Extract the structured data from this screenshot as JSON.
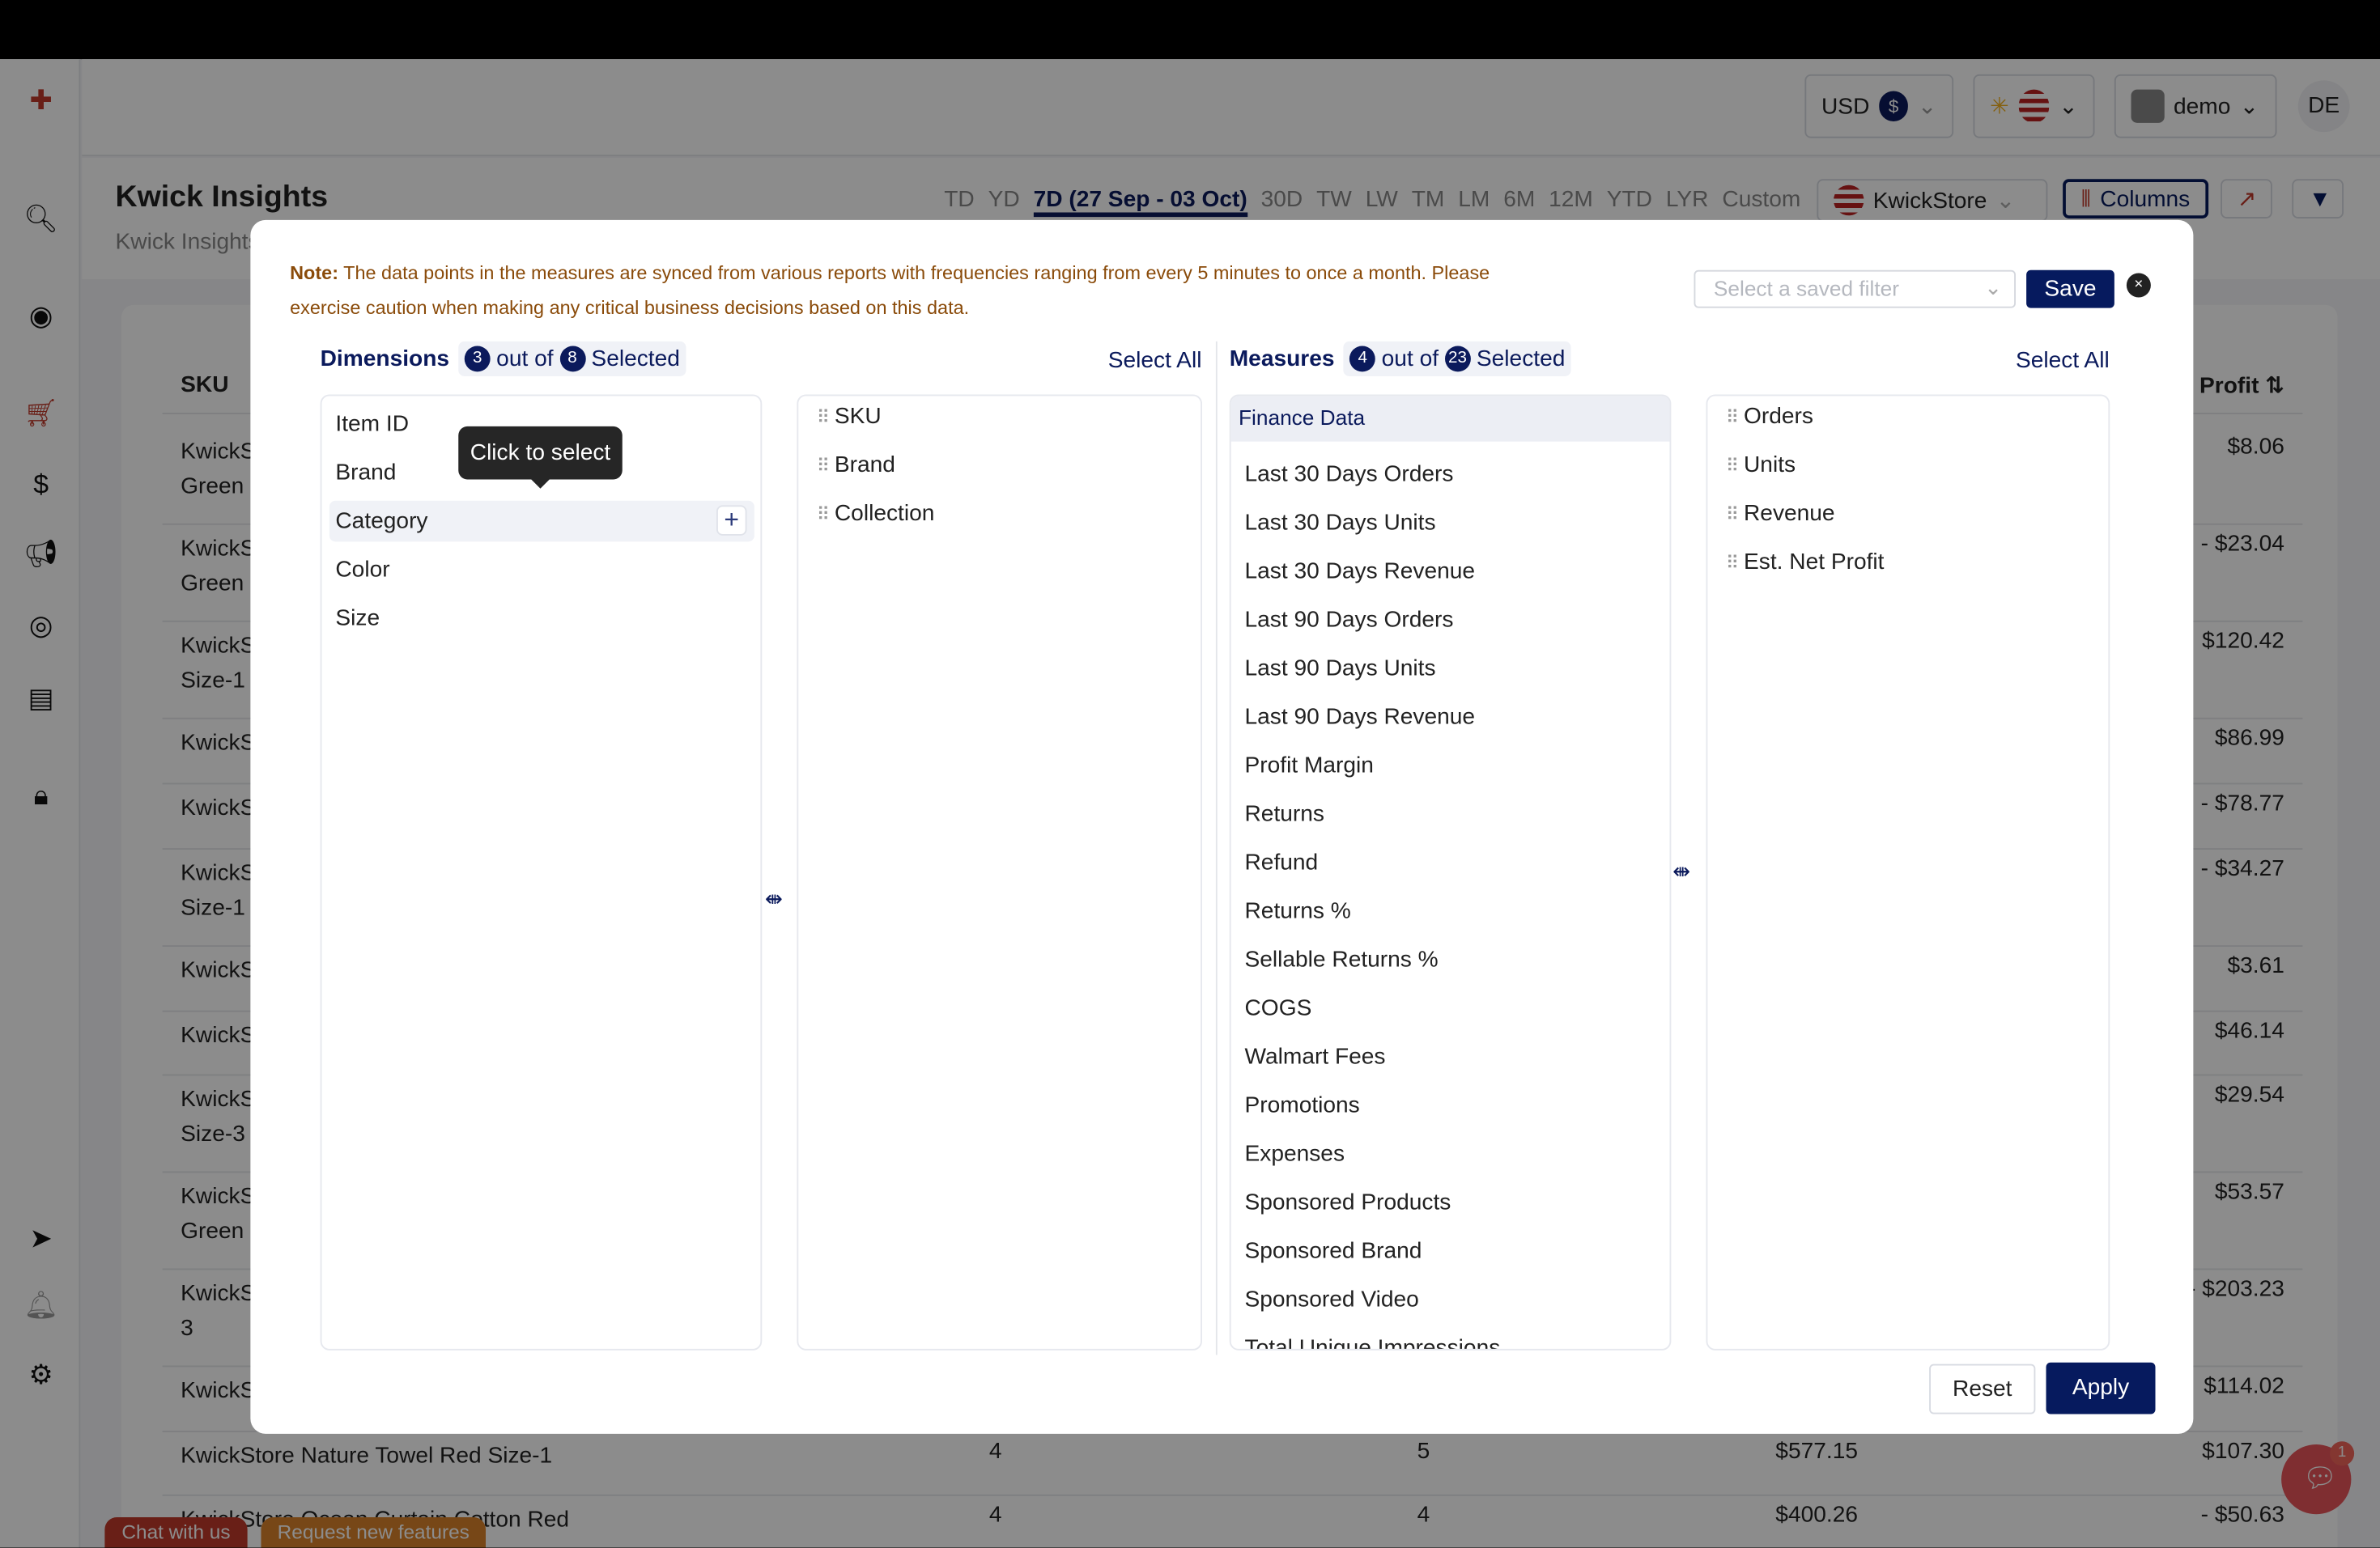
{
  "header": {
    "currency": "USD",
    "currency_symbol": "$",
    "user": "demo",
    "initials": "DE"
  },
  "page": {
    "title": "Kwick Insights",
    "breadcrumb": "Kwick Insights",
    "ranges": [
      "TD",
      "YD",
      "7D (27 Sep - 03 Oct)",
      "30D",
      "TW",
      "LW",
      "TM",
      "LM",
      "6M",
      "12M",
      "YTD",
      "LYR",
      "Custom"
    ],
    "active_range": "7D (27 Sep - 03 Oct)",
    "store": "KwickStore",
    "columns_label": "Columns"
  },
  "table": {
    "headers": {
      "sku": "SKU",
      "profit": "Est. Net Profit"
    },
    "rows": [
      {
        "sku": "KwickS",
        "sku2": "Green S",
        "profit": "$8.06"
      },
      {
        "sku": "KwickS",
        "sku2": "Green S",
        "profit": "- $23.04"
      },
      {
        "sku": "KwickS",
        "sku2": "Size-1",
        "profit": "$120.42"
      },
      {
        "sku": "KwickS",
        "sku2": "",
        "profit": "$86.99"
      },
      {
        "sku": "KwickS",
        "sku2": "",
        "profit": "- $78.77"
      },
      {
        "sku": "KwickS",
        "sku2": "Size-1",
        "profit": "- $34.27"
      },
      {
        "sku": "KwickS",
        "sku2": "",
        "profit": "$3.61"
      },
      {
        "sku": "KwickS",
        "sku2": "",
        "profit": "$46.14"
      },
      {
        "sku": "KwickS",
        "sku2": "Size-3",
        "profit": "$29.54"
      },
      {
        "sku": "KwickS",
        "sku2": "Green S",
        "profit": "$53.57"
      },
      {
        "sku": "KwickS",
        "sku2": "3",
        "profit": "- $203.23"
      },
      {
        "sku": "KwickS",
        "sku2": "",
        "profit": "$114.02"
      }
    ],
    "full_rows": [
      {
        "sku": "KwickStore Nature Towel Red Size-1",
        "orders": "4",
        "units": "5",
        "revenue": "$577.15",
        "profit": "$107.30"
      },
      {
        "sku": "KwickStore Ocean Curtain Cotton Red",
        "orders": "4",
        "units": "4",
        "revenue": "$400.26",
        "profit": "- $50.63"
      }
    ]
  },
  "footer": {
    "chat": "Chat with us",
    "request": "Request new features",
    "chat_badge": "1"
  },
  "modal": {
    "note_label": "Note:",
    "note": "The data points in the measures are synced from various reports with frequencies ranging from every 5 minutes to once a month. Please exercise caution when making any critical business decisions based on this data.",
    "saved_filter_placeholder": "Select a saved filter",
    "save": "Save",
    "close": "×",
    "dimensions": {
      "title": "Dimensions",
      "selected": "3",
      "out_of": "out of",
      "total": "8",
      "selected_label": "Selected",
      "select_all": "Select All",
      "available": [
        "Item ID",
        "Brand",
        "Category",
        "Color",
        "Size"
      ],
      "hovered": "Category",
      "tooltip": "Click to select",
      "chosen": [
        "SKU",
        "Brand",
        "Collection"
      ]
    },
    "measures": {
      "title": "Measures",
      "selected": "4",
      "out_of": "out of",
      "total": "23",
      "selected_label": "Selected",
      "select_all": "Select All",
      "group": "Finance Data",
      "available": [
        "Last 30 Days Orders",
        "Last 30 Days Units",
        "Last 30 Days Revenue",
        "Last 90 Days Orders",
        "Last 90 Days Units",
        "Last 90 Days Revenue",
        "Profit Margin",
        "Returns",
        "Refund",
        "Returns %",
        "Sellable Returns %",
        "COGS",
        "Walmart Fees",
        "Promotions",
        "Expenses",
        "Sponsored Products",
        "Sponsored Brand",
        "Sponsored Video",
        "Total Unique Impressions"
      ],
      "chosen": [
        "Orders",
        "Units",
        "Revenue",
        "Est. Net Profit"
      ]
    },
    "reset": "Reset",
    "apply": "Apply"
  },
  "colors": {
    "primary": "#061a5e",
    "note": "#8a4b0a",
    "chat": "#e8555a"
  }
}
